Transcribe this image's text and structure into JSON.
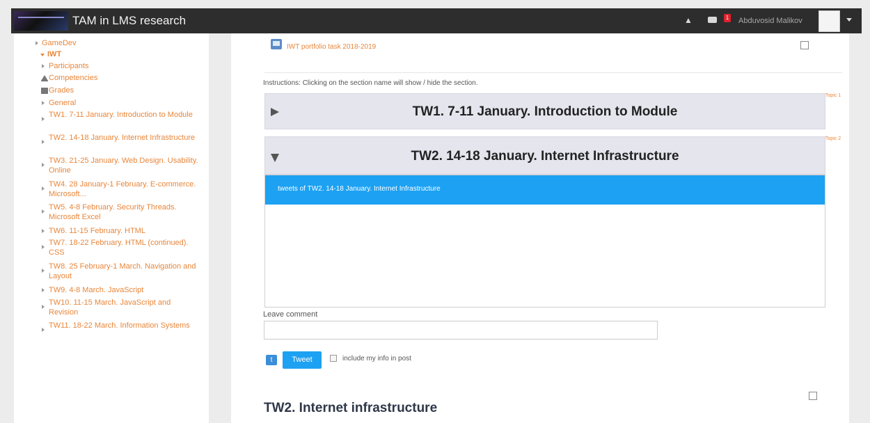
{
  "navbar": {
    "title": "TAM in LMS research",
    "user_name": "Abduvosid Malikov",
    "message_badge": "1",
    "icons": [
      "bell-icon",
      "messages-icon",
      "chevron-down-icon"
    ]
  },
  "sidebar": {
    "items": [
      {
        "label": "GameDev"
      },
      {
        "label": "IWT"
      },
      {
        "label": "Participants"
      },
      {
        "label": "Competencies"
      },
      {
        "label": "Grades"
      },
      {
        "label": "General"
      },
      {
        "label": "TW1. 7-11 January. Introduction to Module"
      },
      {
        "label": "TW2. 14-18 January. Internet Infrastructure"
      },
      {
        "label": "TW3. 21-25 January. Web Design. Usability. Online"
      },
      {
        "label": "TW4. 28 January-1 February. E-commerce. Microsoft..."
      },
      {
        "label": "TW5. 4-8 February. Security Threads. Microsoft Excel"
      },
      {
        "label": "TW6. 11-15 February. HTML"
      },
      {
        "label": "TW7. 18-22 February. HTML (continued). CSS"
      },
      {
        "label": "TW8. 25 February-1 March. Navigation and Layout"
      },
      {
        "label": "TW9. 4-8 March. JavaScript"
      },
      {
        "label": "TW10. 11-15 March. JavaScript and Revision"
      },
      {
        "label": "TW11. 18-22 March. Information Systems"
      }
    ]
  },
  "main": {
    "portfolio_link": "IWT portfolio task 2018-2019",
    "instructions": "Instructions: Clicking on the section name will show / hide the section.",
    "sections": [
      {
        "title": "TW1. 7-11 January. Introduction to Module",
        "topic_note": "Topic 1"
      },
      {
        "title": "TW2. 14-18 January. Internet Infrastructure",
        "topic_note": "Topic 2"
      }
    ],
    "tweet_widget": {
      "header": "tweets of TW2. 14-18 January. Internet Infrastructure",
      "comment_label": "Leave comment",
      "comment_value": "",
      "tweet_button": "Tweet",
      "include_label": "include my info in post"
    },
    "bottom_title": "TW2. Internet infrastructure"
  },
  "colors": {
    "navbar": "#2d2d2d",
    "link_orange": "#e8863a",
    "section_bg": "#e5e5ee",
    "tweet_blue": "#1da1f2"
  }
}
